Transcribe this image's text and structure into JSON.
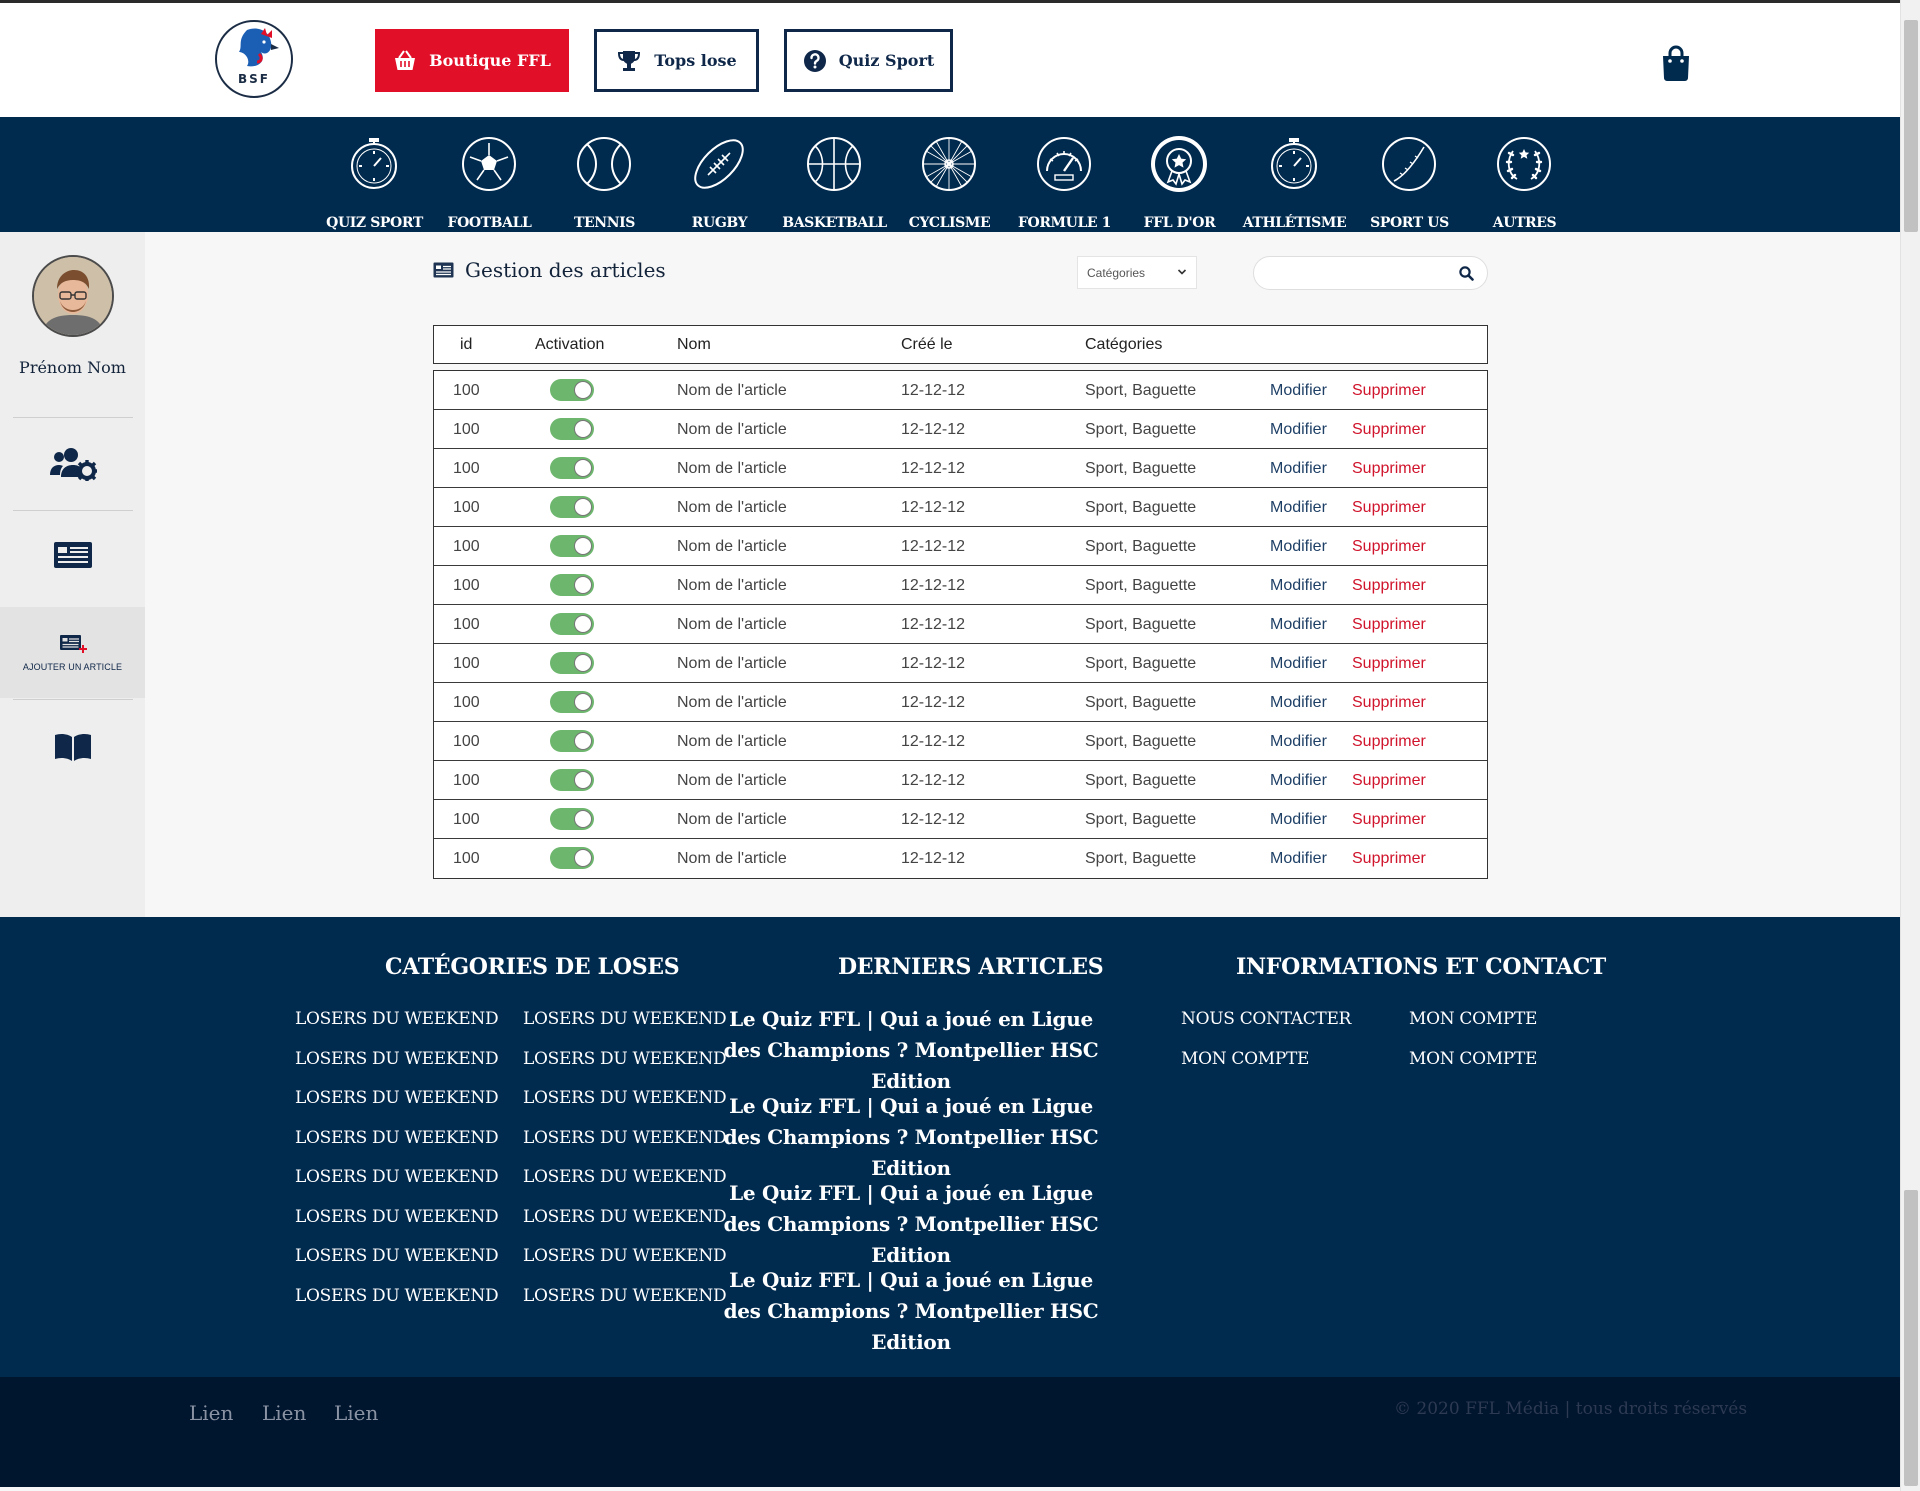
{
  "header": {
    "logo_text": "BSF",
    "buttons": [
      {
        "label": "Boutique FFL",
        "icon": "basket-icon"
      },
      {
        "label": "Tops lose",
        "icon": "trophy-icon"
      },
      {
        "label": "Quiz Sport",
        "icon": "question-circle-icon"
      }
    ],
    "cart_icon": "shopping-bag-icon"
  },
  "sports": [
    {
      "label": "QUIZ SPORT",
      "icon": "stopwatch-icon"
    },
    {
      "label": "FOOTBALL",
      "icon": "soccer-ball-icon"
    },
    {
      "label": "TENNIS",
      "icon": "tennis-ball-icon"
    },
    {
      "label": "RUGBY",
      "icon": "rugby-ball-icon"
    },
    {
      "label": "BASKETBALL",
      "icon": "basketball-icon"
    },
    {
      "label": "CYCLISME",
      "icon": "bicycle-wheel-icon"
    },
    {
      "label": "FORMULE 1",
      "icon": "speedometer-icon"
    },
    {
      "label": "FFL D'OR",
      "icon": "medal-icon"
    },
    {
      "label": "ATHLÉTISME",
      "icon": "stopwatch-icon"
    },
    {
      "label": "SPORT US",
      "icon": "baseball-icon"
    },
    {
      "label": "AUTRES",
      "icon": "laurel-icon"
    }
  ],
  "sidebar": {
    "user_name": "Prénom Nom",
    "add_article_label": "AJOUTER UN ARTICLE"
  },
  "main": {
    "title": "Gestion des articles",
    "category_select": "Catégories",
    "search_placeholder": "",
    "columns": [
      "id",
      "Activation",
      "Nom",
      "Créé le",
      "Catégories"
    ],
    "rows": [
      {
        "id": "100",
        "active": true,
        "name": "Nom de l'article",
        "created": "12-12-12",
        "categories": "Sport, Baguette",
        "edit": "Modifier",
        "delete": "Supprimer"
      },
      {
        "id": "100",
        "active": true,
        "name": "Nom de l'article",
        "created": "12-12-12",
        "categories": "Sport, Baguette",
        "edit": "Modifier",
        "delete": "Supprimer"
      },
      {
        "id": "100",
        "active": true,
        "name": "Nom de l'article",
        "created": "12-12-12",
        "categories": "Sport, Baguette",
        "edit": "Modifier",
        "delete": "Supprimer"
      },
      {
        "id": "100",
        "active": true,
        "name": "Nom de l'article",
        "created": "12-12-12",
        "categories": "Sport, Baguette",
        "edit": "Modifier",
        "delete": "Supprimer"
      },
      {
        "id": "100",
        "active": true,
        "name": "Nom de l'article",
        "created": "12-12-12",
        "categories": "Sport, Baguette",
        "edit": "Modifier",
        "delete": "Supprimer"
      },
      {
        "id": "100",
        "active": true,
        "name": "Nom de l'article",
        "created": "12-12-12",
        "categories": "Sport, Baguette",
        "edit": "Modifier",
        "delete": "Supprimer"
      },
      {
        "id": "100",
        "active": true,
        "name": "Nom de l'article",
        "created": "12-12-12",
        "categories": "Sport, Baguette",
        "edit": "Modifier",
        "delete": "Supprimer"
      },
      {
        "id": "100",
        "active": true,
        "name": "Nom de l'article",
        "created": "12-12-12",
        "categories": "Sport, Baguette",
        "edit": "Modifier",
        "delete": "Supprimer"
      },
      {
        "id": "100",
        "active": true,
        "name": "Nom de l'article",
        "created": "12-12-12",
        "categories": "Sport, Baguette",
        "edit": "Modifier",
        "delete": "Supprimer"
      },
      {
        "id": "100",
        "active": true,
        "name": "Nom de l'article",
        "created": "12-12-12",
        "categories": "Sport, Baguette",
        "edit": "Modifier",
        "delete": "Supprimer"
      },
      {
        "id": "100",
        "active": true,
        "name": "Nom de l'article",
        "created": "12-12-12",
        "categories": "Sport, Baguette",
        "edit": "Modifier",
        "delete": "Supprimer"
      },
      {
        "id": "100",
        "active": true,
        "name": "Nom de l'article",
        "created": "12-12-12",
        "categories": "Sport, Baguette",
        "edit": "Modifier",
        "delete": "Supprimer"
      },
      {
        "id": "100",
        "active": true,
        "name": "Nom de l'article",
        "created": "12-12-12",
        "categories": "Sport, Baguette",
        "edit": "Modifier",
        "delete": "Supprimer"
      }
    ]
  },
  "footer": {
    "categories_title": "CATÉGORIES DE LOSES",
    "category_links": [
      "LOSERS DU WEEKEND",
      "LOSERS DU WEEKEND",
      "LOSERS DU WEEKEND",
      "LOSERS DU WEEKEND",
      "LOSERS DU WEEKEND",
      "LOSERS DU WEEKEND",
      "LOSERS DU WEEKEND",
      "LOSERS DU WEEKEND",
      "LOSERS DU WEEKEND",
      "LOSERS DU WEEKEND",
      "LOSERS DU WEEKEND",
      "LOSERS DU WEEKEND",
      "LOSERS DU WEEKEND",
      "LOSERS DU WEEKEND",
      "LOSERS DU WEEKEND",
      "LOSERS DU WEEKEND"
    ],
    "articles_title": "DERNIERS ARTICLES",
    "articles": [
      "Le Quiz FFL | Qui a joué en Ligue des Champions ? Montpellier HSC Edition",
      "Le Quiz FFL | Qui a joué en Ligue des Champions ? Montpellier HSC Edition",
      "Le Quiz FFL | Qui a joué en Ligue des Champions ? Montpellier HSC Edition",
      "Le Quiz FFL | Qui a joué en Ligue des Champions ? Montpellier HSC Edition"
    ],
    "info_title": "INFORMATIONS ET CONTACT",
    "info_links": [
      "NOUS CONTACTER",
      "MON COMPTE",
      "MON COMPTE",
      "MON COMPTE"
    ],
    "bottom_links": [
      "Lien",
      "Lien",
      "Lien"
    ],
    "copyright": "© 2020 FFL Média | tous droits réservés"
  },
  "colors": {
    "navy": "#002a4e",
    "dark_navy": "#00152e",
    "brand_red": "#e10f28",
    "delete_red": "#d0142c",
    "toggle_green": "#6db66d"
  }
}
